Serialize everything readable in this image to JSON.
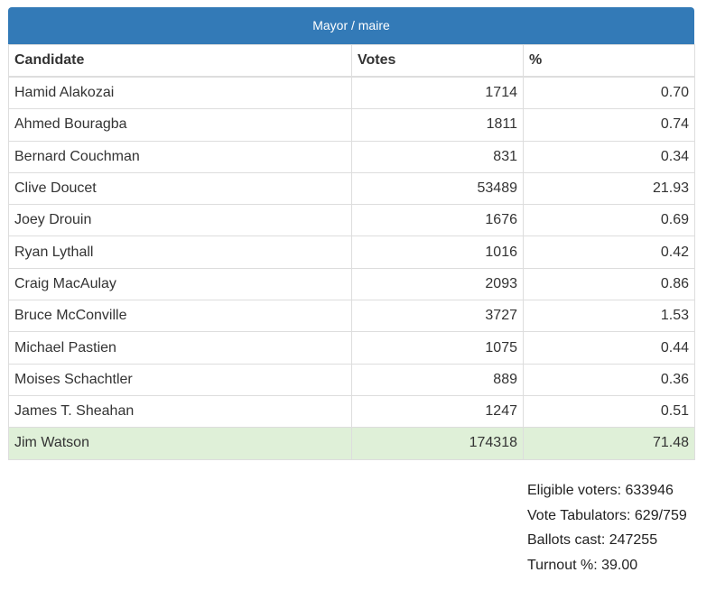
{
  "panel_title": "Mayor / maire",
  "columns": [
    "Candidate",
    "Votes",
    "%"
  ],
  "rows": [
    {
      "candidate": "Hamid Alakozai",
      "votes": "1714",
      "pct": "0.70"
    },
    {
      "candidate": "Ahmed Bouragba",
      "votes": "1811",
      "pct": "0.74"
    },
    {
      "candidate": "Bernard Couchman",
      "votes": "831",
      "pct": "0.34"
    },
    {
      "candidate": "Clive Doucet",
      "votes": "53489",
      "pct": "21.93"
    },
    {
      "candidate": "Joey Drouin",
      "votes": "1676",
      "pct": "0.69"
    },
    {
      "candidate": "Ryan Lythall",
      "votes": "1016",
      "pct": "0.42"
    },
    {
      "candidate": "Craig MacAulay",
      "votes": "2093",
      "pct": "0.86"
    },
    {
      "candidate": "Bruce McConville",
      "votes": "3727",
      "pct": "1.53"
    },
    {
      "candidate": "Michael Pastien",
      "votes": "1075",
      "pct": "0.44"
    },
    {
      "candidate": "Moises Schachtler",
      "votes": "889",
      "pct": "0.36"
    },
    {
      "candidate": "James T. Sheahan",
      "votes": "1247",
      "pct": "0.51"
    },
    {
      "candidate": "Jim Watson",
      "votes": "174318",
      "pct": "71.48",
      "winner": true
    }
  ],
  "stats": [
    "Eligible voters: 633946",
    "Vote Tabulators: 629/759",
    "Ballots cast: 247255",
    "Turnout %: 39.00"
  ]
}
